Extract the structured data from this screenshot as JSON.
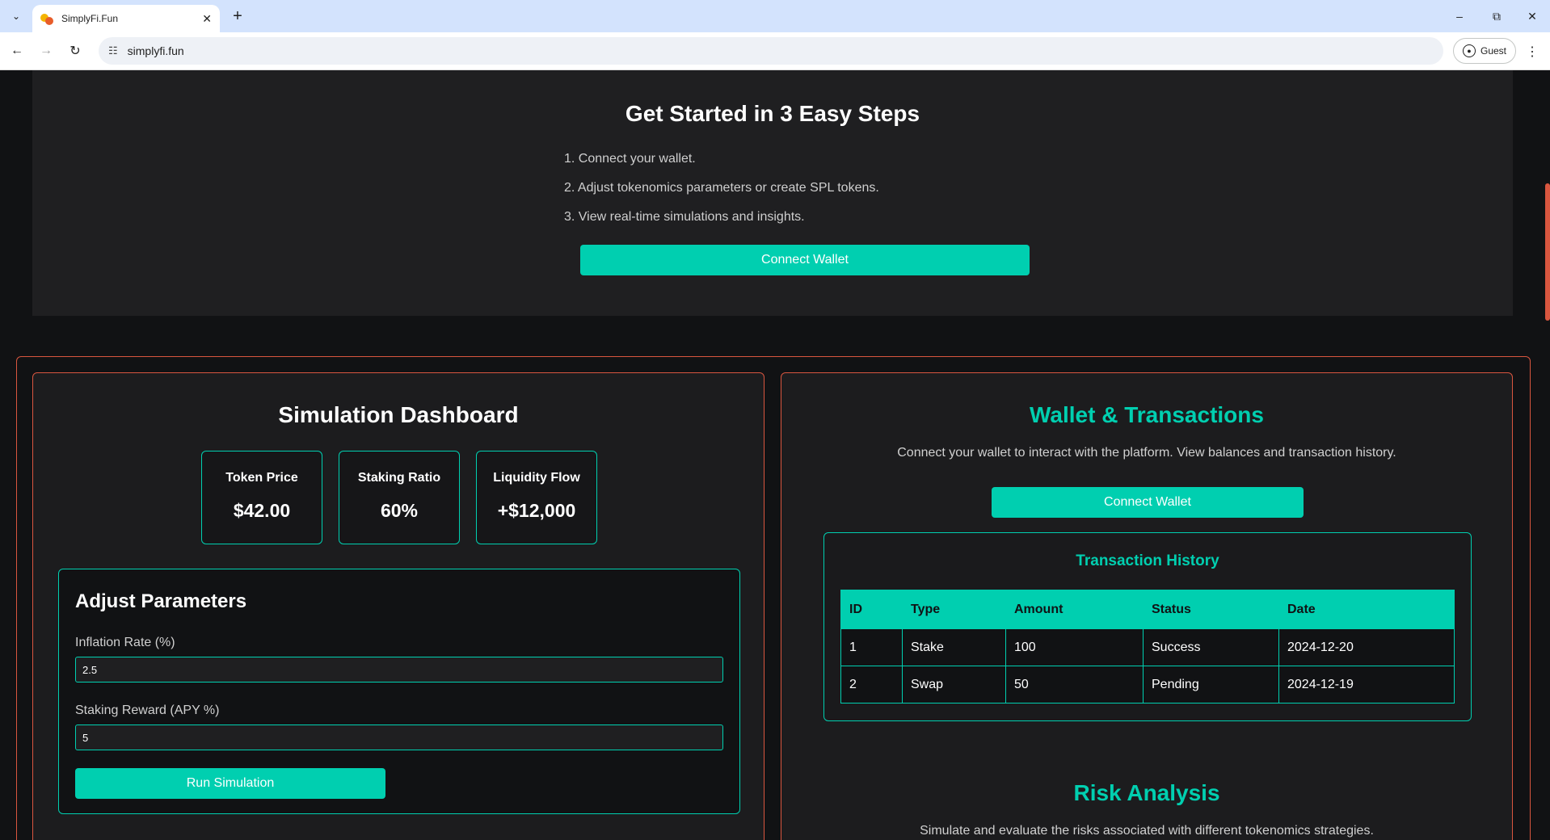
{
  "browser": {
    "tab_title": "SimplyFi.Fun",
    "url": "simplyfi.fun",
    "profile_label": "Guest"
  },
  "steps": {
    "title": "Get Started in 3 Easy Steps",
    "items": [
      "1. Connect your wallet.",
      "2. Adjust tokenomics parameters or create SPL tokens.",
      "3. View real-time simulations and insights."
    ],
    "connect_label": "Connect Wallet"
  },
  "simulation": {
    "title": "Simulation Dashboard",
    "metrics": [
      {
        "label": "Token Price",
        "value": "$42.00"
      },
      {
        "label": "Staking Ratio",
        "value": "60%"
      },
      {
        "label": "Liquidity Flow",
        "value": "+$12,000"
      }
    ],
    "params": {
      "title": "Adjust Parameters",
      "inflation_label": "Inflation Rate (%)",
      "inflation_value": "2.5",
      "staking_label": "Staking Reward (APY %)",
      "staking_value": "5",
      "run_label": "Run Simulation"
    }
  },
  "wallet": {
    "title": "Wallet & Transactions",
    "description": "Connect your wallet to interact with the platform. View balances and transaction history.",
    "connect_label": "Connect Wallet",
    "history_title": "Transaction History",
    "columns": [
      "ID",
      "Type",
      "Amount",
      "Status",
      "Date"
    ],
    "rows": [
      [
        "1",
        "Stake",
        "100",
        "Success",
        "2024-12-20"
      ],
      [
        "2",
        "Swap",
        "50",
        "Pending",
        "2024-12-19"
      ]
    ]
  },
  "risk": {
    "title": "Risk Analysis",
    "description": "Simulate and evaluate the risks associated with different tokenomics strategies."
  },
  "colors": {
    "accent": "#00cfb0",
    "frame": "#d9563f",
    "background": "#111214"
  }
}
